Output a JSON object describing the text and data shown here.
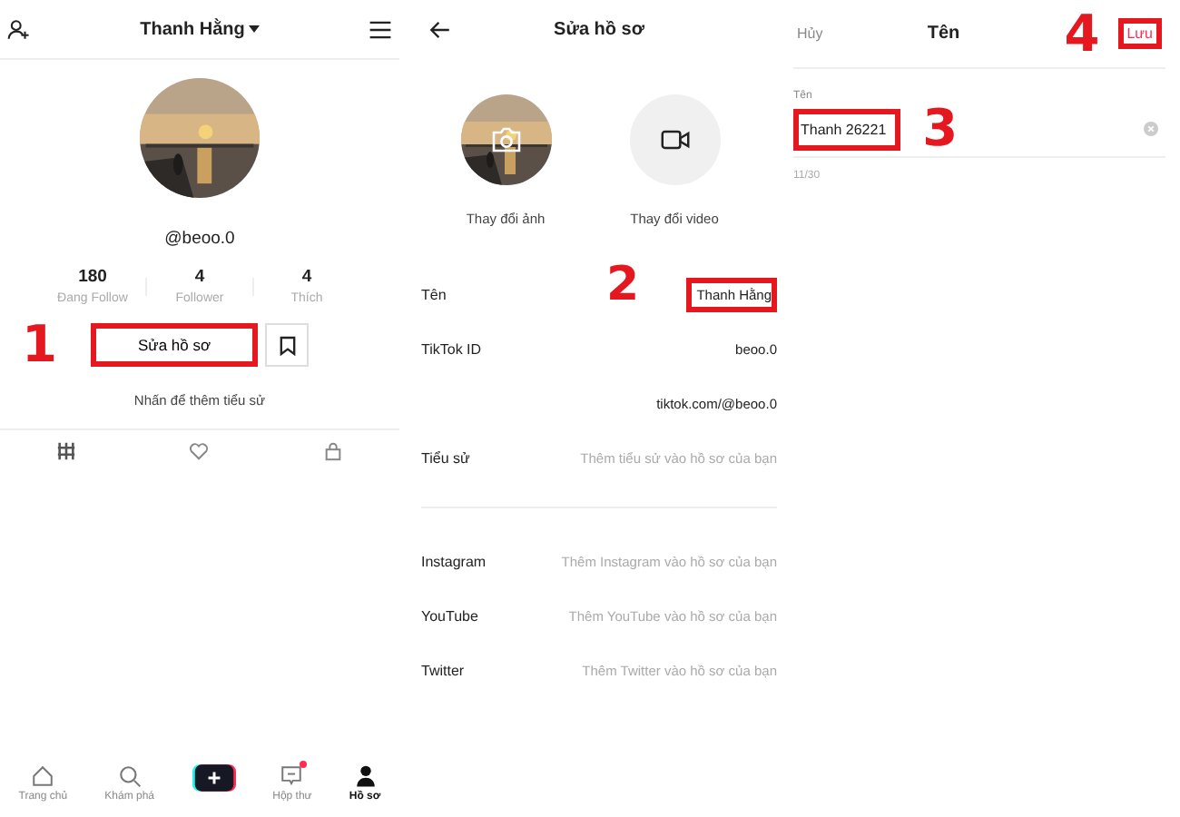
{
  "profile": {
    "title": "Thanh Hằng",
    "username": "@beoo.0",
    "stats": [
      {
        "value": "180",
        "label": "Đang Follow"
      },
      {
        "value": "4",
        "label": "Follower"
      },
      {
        "value": "4",
        "label": "Thích"
      }
    ],
    "edit_button": {
      "label": "Sửa hồ sơ",
      "highlighted": true
    },
    "step": "1",
    "bio_hint": "Nhấn để thêm tiểu sử",
    "nav": [
      {
        "kind": "home",
        "label": "Trang chủ",
        "selected": false,
        "badge": false
      },
      {
        "kind": "search",
        "label": "Khám phá",
        "selected": false,
        "badge": false
      },
      {
        "kind": "create",
        "selected": false,
        "badge": false
      },
      {
        "kind": "inbox",
        "label": "Hộp thư",
        "selected": false,
        "badge": true
      },
      {
        "kind": "profile",
        "label": "Hồ sơ",
        "selected": true,
        "badge": false
      }
    ]
  },
  "edit_profile": {
    "title": "Sửa hồ sơ",
    "media": [
      {
        "label": "Thay đổi ảnh"
      },
      {
        "kind": "video",
        "label": "Thay đổi video"
      }
    ],
    "step": "2",
    "fields": [
      {
        "label": "Tên",
        "value": "Thanh Hằng",
        "highlighted": true
      },
      {
        "label": "TikTok ID",
        "value": "beoo.0",
        "highlighted": false
      },
      {
        "value": "tiktok.com/@beoo.0",
        "highlighted": false
      },
      {
        "label": "Tiểu sử",
        "placeholder": "Thêm tiểu sử vào hồ sơ của bạn",
        "highlighted": false
      }
    ],
    "social": [
      {
        "label": "Instagram",
        "placeholder": "Thêm Instagram vào hồ sơ của bạn"
      },
      {
        "label": "YouTube",
        "placeholder": "Thêm YouTube vào hồ sơ của bạn"
      },
      {
        "label": "Twitter",
        "placeholder": "Thêm Twitter vào hồ sơ của bạn"
      }
    ]
  },
  "name_editor": {
    "cancel": "Hủy",
    "title": "Tên",
    "save": {
      "label": "Lưu",
      "highlighted": true
    },
    "step_save": "4",
    "field_label": "Tên",
    "field": {
      "value": "Thanh 26221",
      "highlighted": true
    },
    "step_field": "3",
    "counter": "11/30"
  }
}
